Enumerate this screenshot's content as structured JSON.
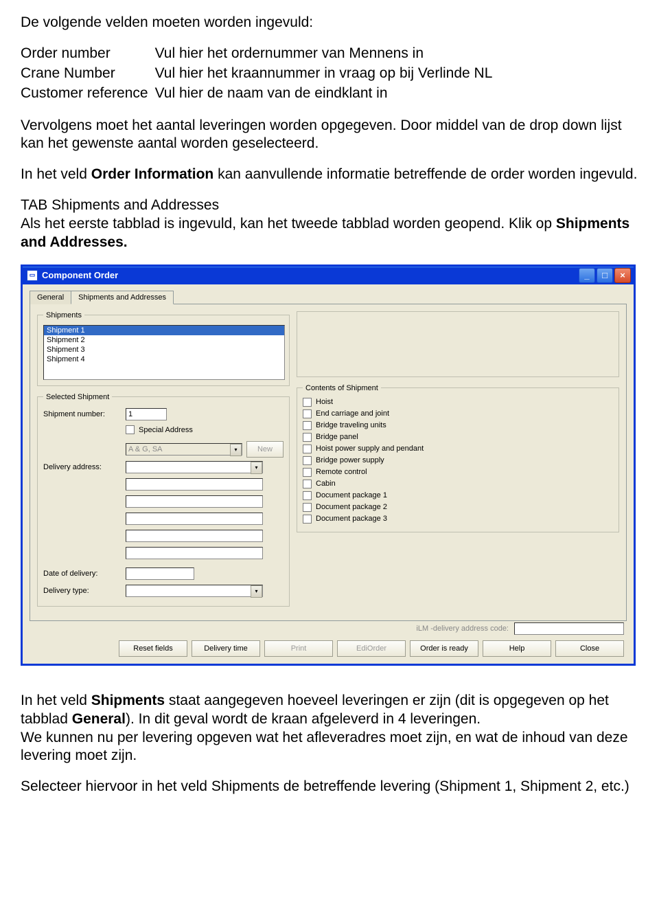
{
  "doc": {
    "intro": "De volgende velden moeten worden ingevuld:",
    "fields": {
      "order_number_label": "Order number",
      "order_number_desc": "Vul hier het ordernummer van Mennens in",
      "crane_number_label": "Crane Number",
      "crane_number_desc": "Vul hier het kraannummer in vraag op bij Verlinde NL",
      "customer_ref_label": "Customer reference",
      "customer_ref_desc": "Vul hier de naam van de eindklant in"
    },
    "para2": "Vervolgens moet het aantal leveringen worden opgegeven. Door middel van de drop down lijst kan het gewenste aantal worden geselecteerd.",
    "para3_a": "In het veld ",
    "para3_b": "Order Information",
    "para3_c": "  kan aanvullende informatie betreffende de order worden ingevuld.",
    "tab_heading": "TAB Shipments and Addresses",
    "para4_a": "Als het eerste tabblad is ingevuld, kan het tweede tabblad worden geopend. Klik op ",
    "para4_b": "Shipments and Addresses.",
    "after1_a": "In het veld ",
    "after1_b": "Shipments",
    "after1_c": " staat aangegeven hoeveel leveringen er zijn (dit is opgegeven op het tabblad ",
    "after1_d": "General",
    "after1_e": "). In dit geval wordt de kraan afgeleverd in 4 leveringen.",
    "after2": "We kunnen nu per levering opgeven wat het afleveradres moet zijn, en wat de inhoud van deze levering moet zijn.",
    "after3": "Selecteer hiervoor in het veld Shipments de betreffende levering (Shipment 1, Shipment 2, etc.)"
  },
  "win": {
    "title": "Component Order",
    "tabs": {
      "general": "General",
      "ship": "Shipments and Addresses"
    },
    "groups": {
      "shipments": "Shipments",
      "selected": "Selected Shipment",
      "contents": "Contents of Shipment"
    },
    "shipments_list": [
      "Shipment 1",
      "Shipment 2",
      "Shipment 3",
      "Shipment 4"
    ],
    "labels": {
      "shipment_number": "Shipment number:",
      "special_address": "Special Address",
      "delivery_address": "Delivery address:",
      "date_of_delivery": "Date of delivery:",
      "delivery_type": "Delivery type:",
      "ilm": "iLM -delivery address code:"
    },
    "values": {
      "shipment_number": "1",
      "address_combo": "A & G, SA"
    },
    "contents": [
      "Hoist",
      "End carriage and joint",
      "Bridge traveling units",
      "Bridge panel",
      "Hoist power supply and pendant",
      "Bridge power supply",
      "Remote control",
      "Cabin",
      "Document package 1",
      "Document package 2",
      "Document package 3"
    ],
    "buttons": {
      "new": "New",
      "reset": "Reset fields",
      "delivery_time": "Delivery time",
      "print": "Print",
      "ediorder": "EdiOrder",
      "ready": "Order is ready",
      "help": "Help",
      "close": "Close"
    }
  }
}
